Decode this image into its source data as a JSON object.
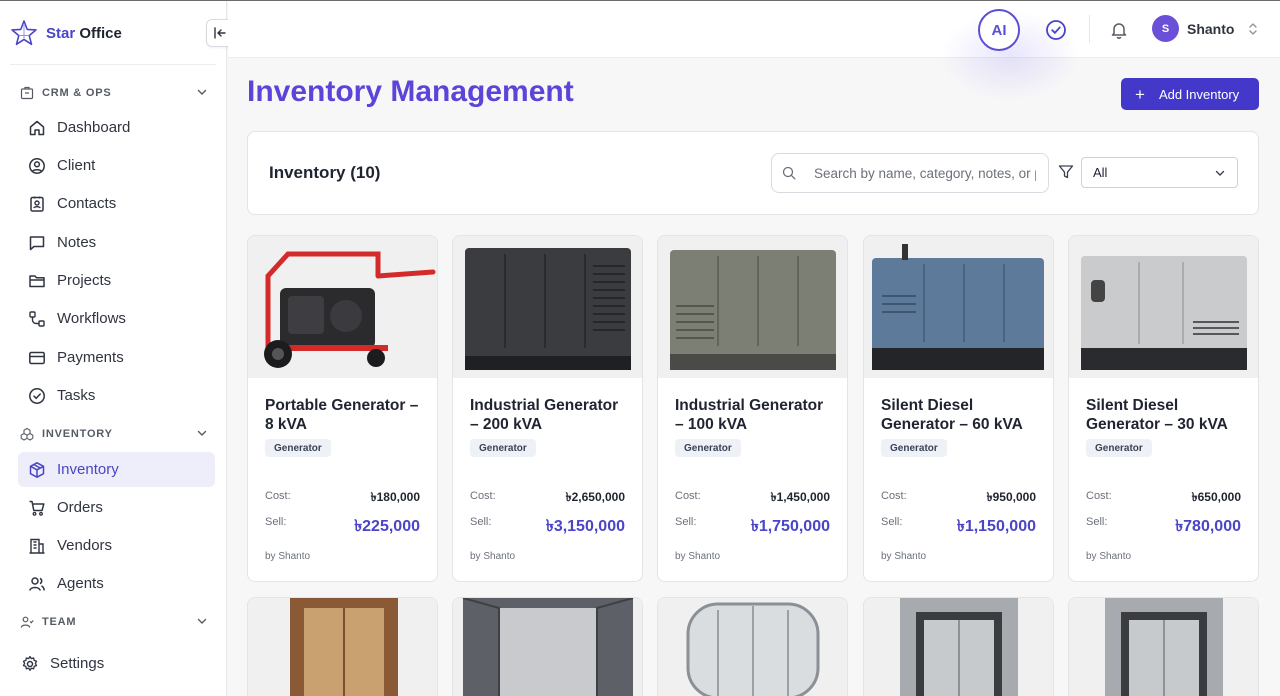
{
  "app": {
    "brand_a": "Star",
    "brand_b": " Office"
  },
  "sidebar": {
    "sections": [
      {
        "label": "CRM & OPS",
        "icon": "building-icon"
      },
      {
        "label": "INVENTORY",
        "icon": "boxes-icon"
      },
      {
        "label": "TEAM",
        "icon": "team-icon"
      }
    ],
    "items": [
      {
        "label": "Dashboard",
        "icon": "home-icon"
      },
      {
        "label": "Client",
        "icon": "user-circle-icon"
      },
      {
        "label": "Contacts",
        "icon": "contact-card-icon"
      },
      {
        "label": "Notes",
        "icon": "message-square-icon"
      },
      {
        "label": "Projects",
        "icon": "folder-icon"
      },
      {
        "label": "Workflows",
        "icon": "workflow-icon"
      },
      {
        "label": "Payments",
        "icon": "credit-card-icon"
      },
      {
        "label": "Tasks",
        "icon": "check-circle-icon"
      },
      {
        "label": "Inventory",
        "icon": "package-icon",
        "active": true
      },
      {
        "label": "Orders",
        "icon": "cart-icon"
      },
      {
        "label": "Vendors",
        "icon": "building-icon"
      },
      {
        "label": "Agents",
        "icon": "users-icon"
      },
      {
        "label": "Settings",
        "icon": "gear-icon"
      }
    ]
  },
  "topbar": {
    "ai_label": "AI",
    "user_initial": "S",
    "user_name": "Shanto"
  },
  "main": {
    "title": "Inventory Management",
    "add_button": "Add Inventory",
    "count_label": "Inventory (10)",
    "search_placeholder": "Search by name, category, notes, or price",
    "filter_value": "All"
  },
  "cards": [
    {
      "title": "Portable Generator – 8 kVA",
      "category": "Generator",
      "cost_label": "Cost:",
      "cost": "৳180,000",
      "sell_label": "Sell:",
      "sell": "৳225,000",
      "by": "by Shanto"
    },
    {
      "title": "Industrial Generator – 200 kVA",
      "category": "Generator",
      "cost_label": "Cost:",
      "cost": "৳2,650,000",
      "sell_label": "Sell:",
      "sell": "৳3,150,000",
      "by": "by Shanto"
    },
    {
      "title": "Industrial Generator – 100 kVA",
      "category": "Generator",
      "cost_label": "Cost:",
      "cost": "৳1,450,000",
      "sell_label": "Sell:",
      "sell": "৳1,750,000",
      "by": "by Shanto"
    },
    {
      "title": "Silent Diesel Generator – 60 kVA",
      "category": "Generator",
      "cost_label": "Cost:",
      "cost": "৳950,000",
      "sell_label": "Sell:",
      "sell": "৳1,150,000",
      "by": "by Shanto"
    },
    {
      "title": "Silent Diesel Generator – 30 kVA",
      "category": "Generator",
      "cost_label": "Cost:",
      "cost": "৳650,000",
      "sell_label": "Sell:",
      "sell": "৳780,000",
      "by": "by Shanto"
    }
  ],
  "colors": {
    "accent": "#4a45c7",
    "title": "#5b45d8",
    "button": "#4338ca"
  }
}
